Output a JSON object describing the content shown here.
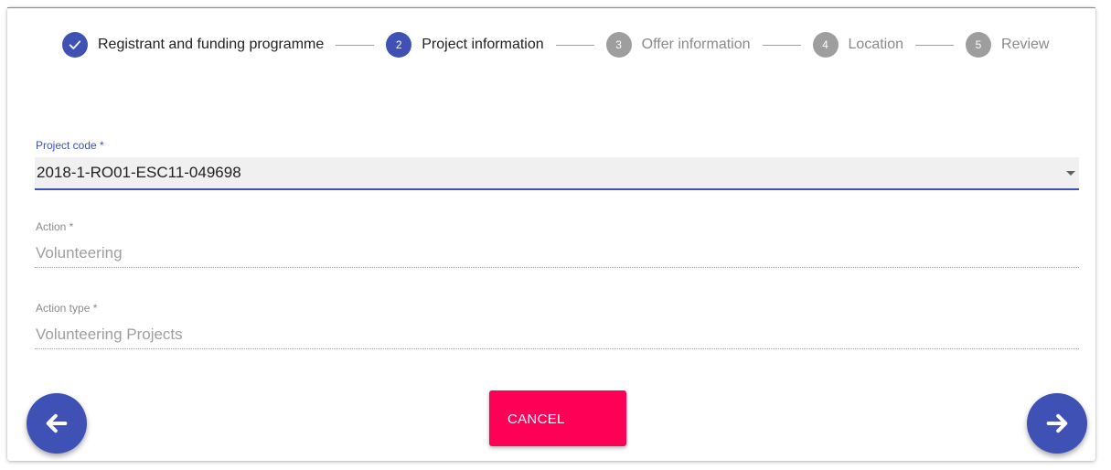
{
  "stepper": {
    "steps": [
      {
        "number": "",
        "label": "Registrant and funding programme",
        "state": "completed",
        "icon": "check-icon"
      },
      {
        "number": "2",
        "label": "Project information",
        "state": "active"
      },
      {
        "number": "3",
        "label": "Offer information",
        "state": "pending"
      },
      {
        "number": "4",
        "label": "Location",
        "state": "pending"
      },
      {
        "number": "5",
        "label": "Review",
        "state": "pending"
      }
    ]
  },
  "form": {
    "project_code": {
      "label": "Project code *",
      "value": "2018-1-RO01-ESC11-049698"
    },
    "action": {
      "label": "Action *",
      "value": "Volunteering"
    },
    "action_type": {
      "label": "Action type *",
      "value": "Volunteering Projects"
    }
  },
  "buttons": {
    "cancel_label": "CANCEL",
    "prev_icon": "arrow-left-icon",
    "next_icon": "arrow-right-icon"
  },
  "colors": {
    "primary": "#3f51b5",
    "accent": "#ff0057",
    "pending": "#9e9e9e"
  }
}
